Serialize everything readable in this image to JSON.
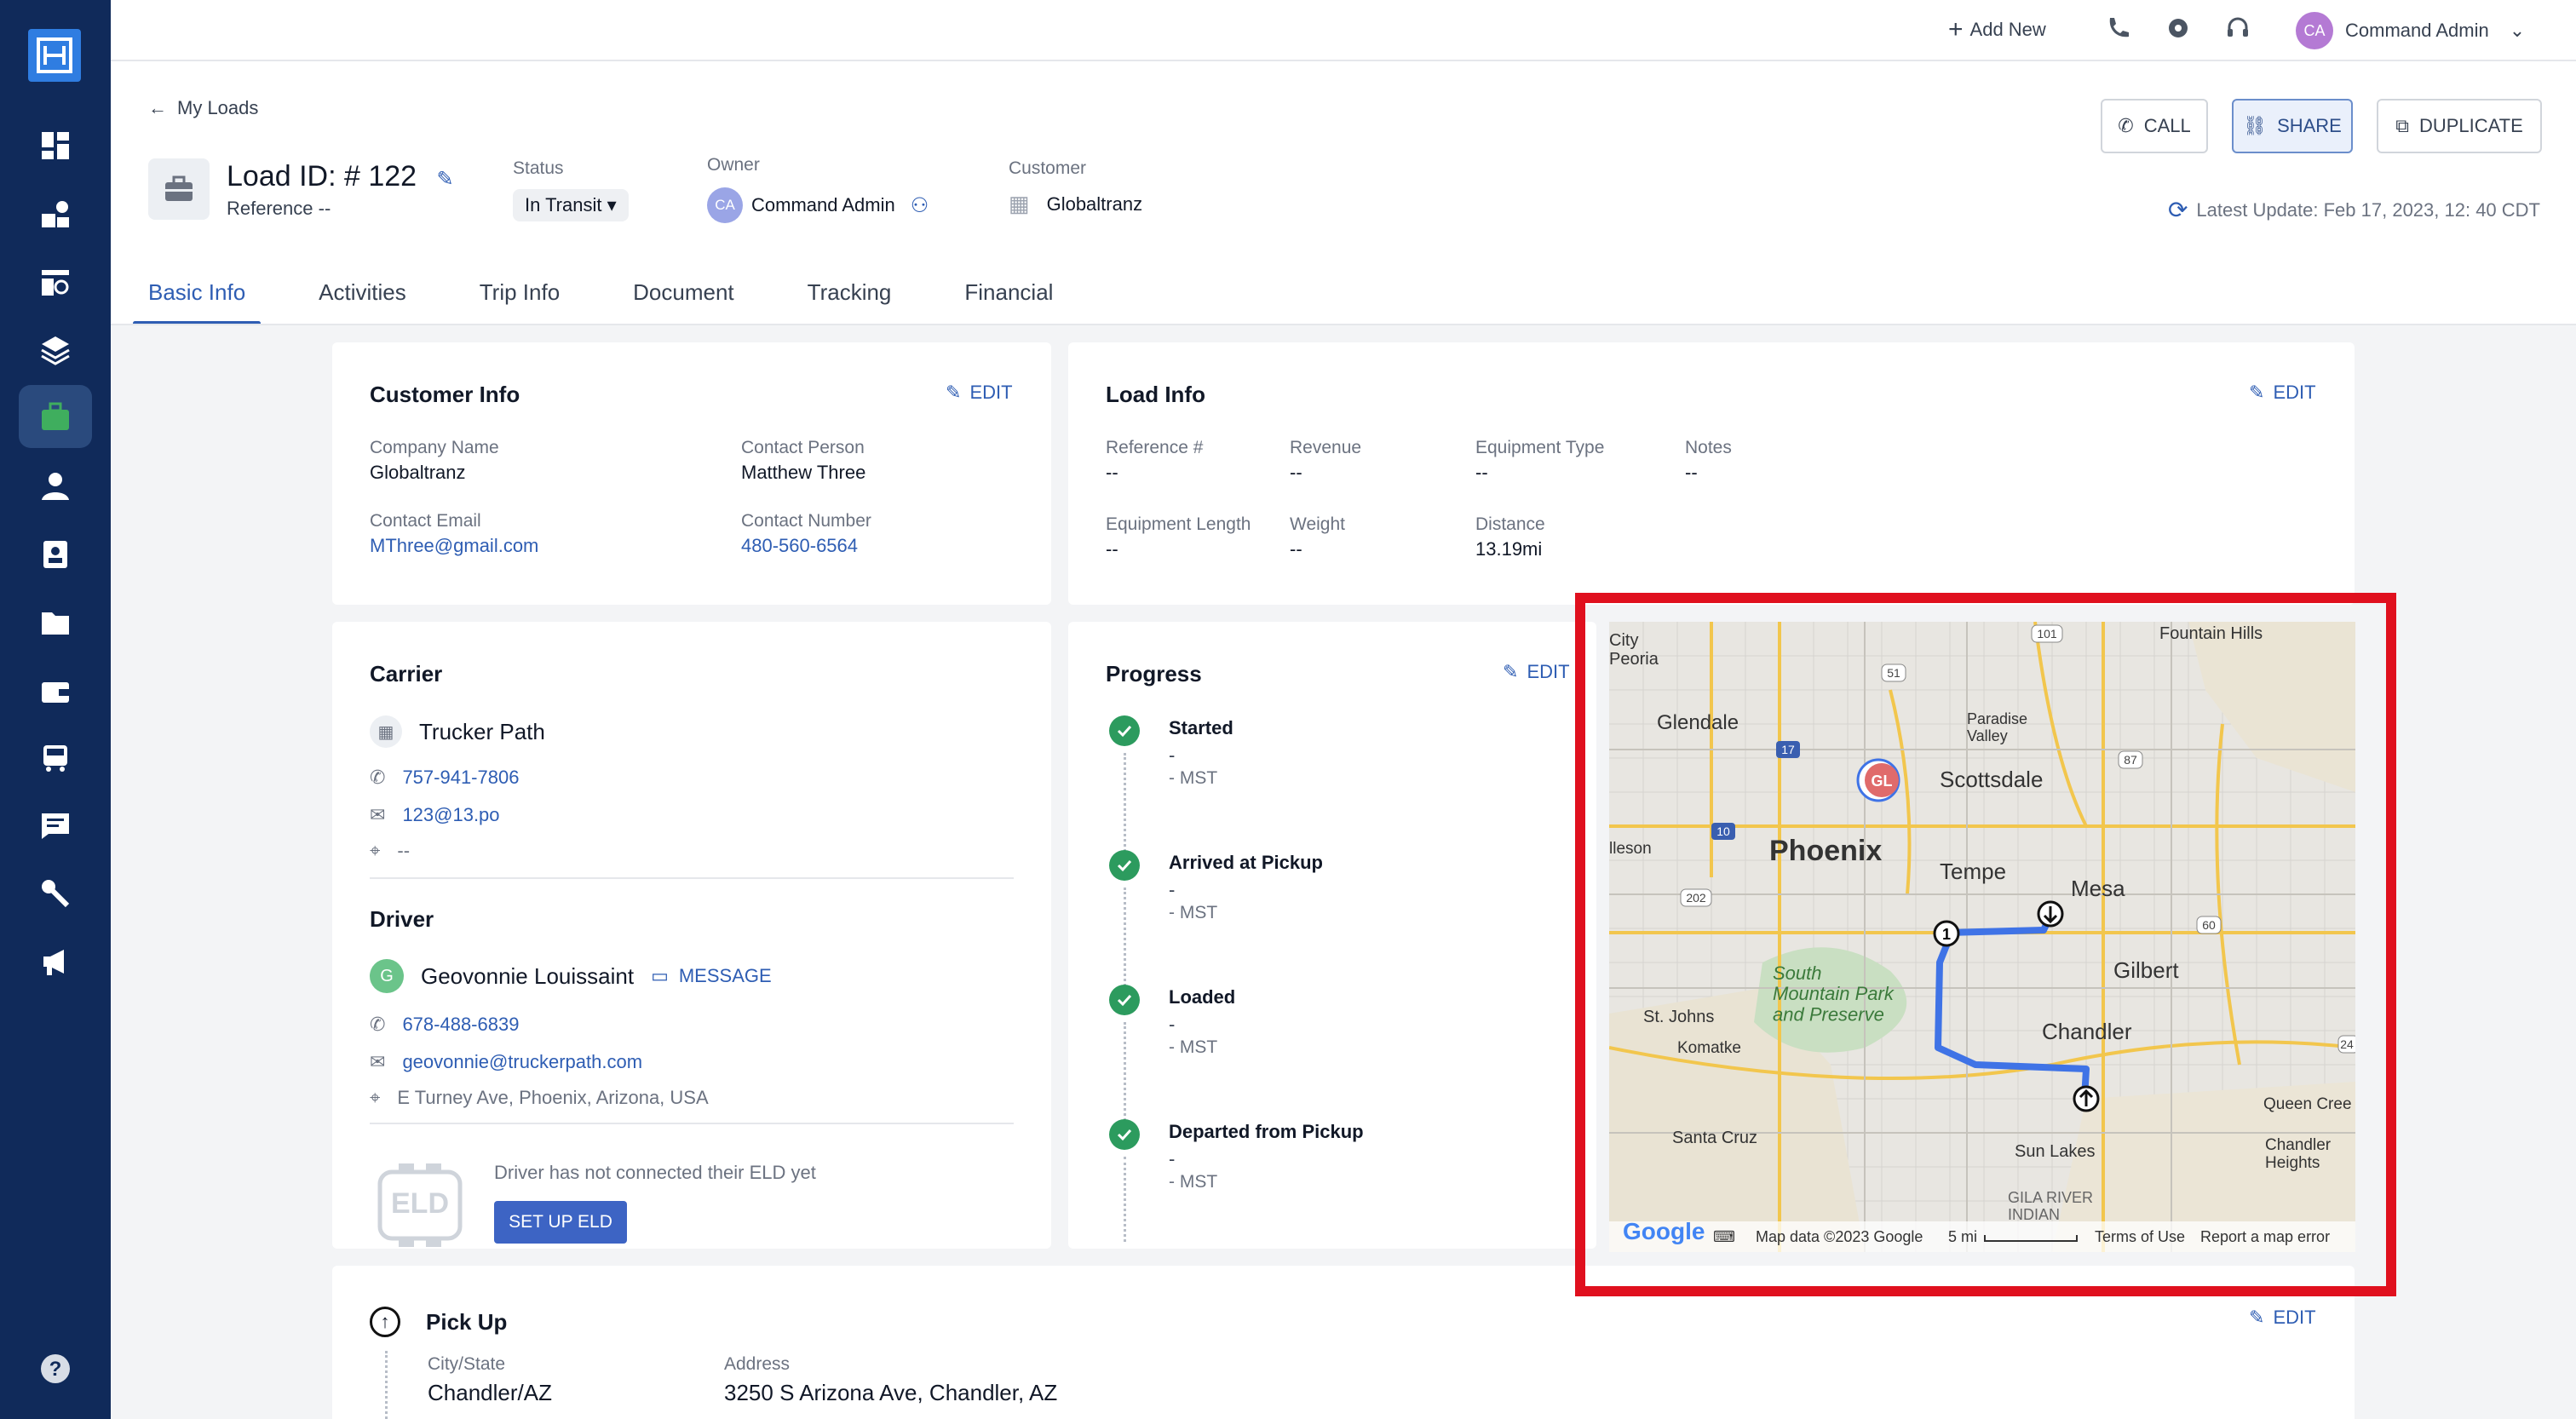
{
  "topbar": {
    "add_new": "Add New",
    "user_initials": "CA",
    "user_name": "Command Admin"
  },
  "header": {
    "back_label": "My Loads",
    "load_title": "Load ID: # 122",
    "reference": "Reference --",
    "status_label": "Status",
    "status_value": "In Transit",
    "owner_label": "Owner",
    "owner_initials": "CA",
    "owner_name": "Command Admin",
    "customer_label": "Customer",
    "customer_name": "Globaltranz",
    "call_label": "CALL",
    "share_label": "SHARE",
    "duplicate_label": "DUPLICATE",
    "latest_update": "Latest Update: Feb 17, 2023, 12: 40 CDT"
  },
  "tabs": [
    "Basic Info",
    "Activities",
    "Trip Info",
    "Document",
    "Tracking",
    "Financial"
  ],
  "customer_info": {
    "title": "Customer Info",
    "edit": "EDIT",
    "company_name_label": "Company Name",
    "company_name": "Globaltranz",
    "contact_person_label": "Contact Person",
    "contact_person": "Matthew Three",
    "contact_email_label": "Contact Email",
    "contact_email": "MThree@gmail.com",
    "contact_number_label": "Contact Number",
    "contact_number": "480-560-6564"
  },
  "load_info": {
    "title": "Load Info",
    "edit": "EDIT",
    "fields": [
      {
        "label": "Reference #",
        "value": "--"
      },
      {
        "label": "Revenue",
        "value": "--"
      },
      {
        "label": "Equipment Type",
        "value": "--"
      },
      {
        "label": "Notes",
        "value": "--"
      },
      {
        "label": "Equipment Length",
        "value": "--"
      },
      {
        "label": "Weight",
        "value": "--"
      },
      {
        "label": "Distance",
        "value": "13.19mi"
      }
    ]
  },
  "carrier": {
    "title": "Carrier",
    "name": "Trucker Path",
    "phone": "757-941-7806",
    "email": "123@13.po",
    "location": "--"
  },
  "driver": {
    "title": "Driver",
    "initial": "G",
    "name": "Geovonnie Louissaint",
    "message": "MESSAGE",
    "phone": "678-488-6839",
    "email": "geovonnie@truckerpath.com",
    "address": "E Turney Ave, Phoenix, Arizona, USA",
    "eld_notice": "Driver has not connected their ELD yet",
    "eld_badge": "ELD",
    "setup_button": "SET UP ELD"
  },
  "progress": {
    "title": "Progress",
    "edit": "EDIT",
    "steps": [
      {
        "name": "Started",
        "value": "-",
        "time": "- MST"
      },
      {
        "name": "Arrived at Pickup",
        "value": "-",
        "time": "- MST"
      },
      {
        "name": "Loaded",
        "value": "-",
        "time": "- MST"
      },
      {
        "name": "Departed from Pickup",
        "value": "-",
        "time": "- MST"
      }
    ]
  },
  "pickup": {
    "title": "Pick Up",
    "edit": "EDIT",
    "city_label": "City/State",
    "city_value": "Chandler/AZ",
    "address_label": "Address",
    "address_value": "3250 S Arizona Ave, Chandler, AZ"
  },
  "map": {
    "labels": {
      "city_peoria": "City\nPeoria",
      "glendale": "Glendale",
      "paradise_valley": "Paradise\nValley",
      "scottsdale": "Scottsdale",
      "fountain_hills": "Fountain Hills",
      "avondale": "lleson",
      "phoenix": "Phoenix",
      "tempe": "Tempe",
      "mesa": "Mesa",
      "gilbert": "Gilbert",
      "south_mountain": "South\nMountain Park\nand Preserve",
      "st_johns": "St. Johns",
      "komatke": "Komatke",
      "chandler": "Chandler",
      "queen_creek": "Queen Cree",
      "santa_cruz": "Santa Cruz",
      "sun_lakes": "Sun Lakes",
      "chandler_heights": "Chandler\nHeights",
      "gila_river": "GILA RIVER\nINDIAN",
      "gl_marker": "GL",
      "waypoint_start": "1"
    },
    "highways": [
      "101",
      "51",
      "17",
      "10",
      "202",
      "87",
      "60",
      "24"
    ],
    "footer": {
      "google": "Google",
      "map_data": "Map data ©2023 Google",
      "scale": "5 mi",
      "terms": "Terms of Use",
      "report": "Report a map error"
    },
    "route_color": "#3f73e6"
  }
}
